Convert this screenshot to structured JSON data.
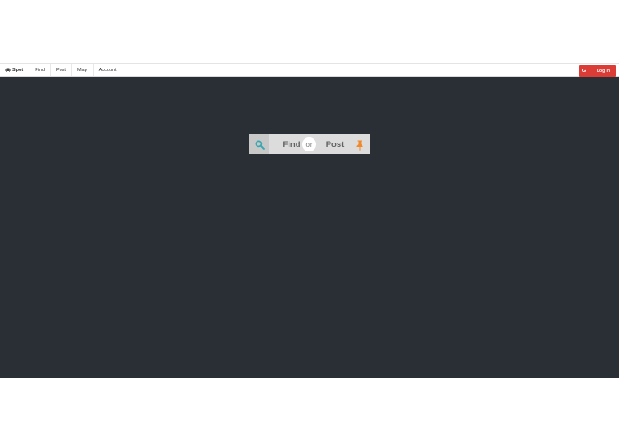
{
  "nav": {
    "brand": "Spot",
    "items": [
      {
        "label": "Find"
      },
      {
        "label": "Post"
      },
      {
        "label": "Map"
      },
      {
        "label": "Account"
      }
    ],
    "login": {
      "icon": "G",
      "label": "Log In"
    }
  },
  "hero": {
    "find_label": "Find",
    "or_label": "or",
    "post_label": "Post"
  },
  "colors": {
    "hero_bg": "#2a2e35",
    "login_red": "#db3c36",
    "find_icon_teal": "#3aa7b0",
    "pin_icon_orange": "#f0892a"
  },
  "icons": {
    "brand": "car-icon",
    "login": "google-icon",
    "find": "search-icon",
    "post": "pin-icon"
  }
}
